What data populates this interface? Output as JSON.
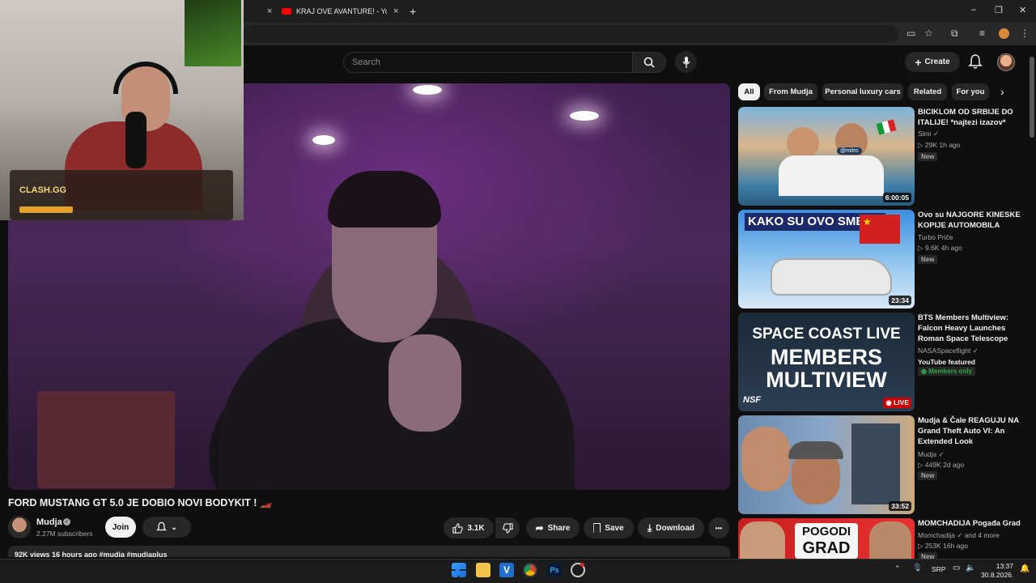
{
  "browser": {
    "tab_title": "KRAJ OVE AVANTURE! - YouTube",
    "tab_close": "×",
    "new_tab": "+",
    "window_controls": [
      "–",
      "❐",
      "✕"
    ]
  },
  "yt_header": {
    "search_placeholder": "Search",
    "create_label": "Create"
  },
  "webcam_overlay": {
    "sponsor_logo": "CLASH.GG"
  },
  "video": {
    "title": "FORD MUSTANG GT 5.0 JE DOBIO NOVI BODYKIT ! 🏎️",
    "channel": "Mudja",
    "subscribers": "2.27M subscribers",
    "join_label": "Join",
    "likes": "3.1K",
    "share_label": "Share",
    "save_label": "Save",
    "download_label": "Download",
    "more_label": "•••",
    "views_line": "92K views  16 hours ago  #mudja  #mudjaplus"
  },
  "chips": [
    "All",
    "From Mudja",
    "Personal luxury cars",
    "Related",
    "For you"
  ],
  "recommendations": [
    {
      "title": "BICIKLOM OD SRBIJE DO ITALIJE! *najtezi izazov*",
      "channel": "Simi",
      "verified": true,
      "stats": "▷ 29K  1h ago",
      "badge": "New",
      "duration": "6:00:05",
      "thumb_text": "@mitro"
    },
    {
      "title": "Ovo su NAJGORE KINESKE KOPIJE AUTOMOBILA",
      "channel": "Turbo Priče",
      "verified": false,
      "stats": "▷ 9.6K  4h ago",
      "badge": "New",
      "duration": "23:34",
      "thumb_text": "KAKO SU OVO SMELI?"
    },
    {
      "title": "BTS Members Multiview: Falcon Heavy Launches Roman Space Telescope",
      "channel": "NASASpaceflight",
      "verified": true,
      "stats": "YouTube featured",
      "badge": "Members only",
      "duration": "LIVE",
      "thumb_text_1": "SPACE COAST LIVE",
      "thumb_text_2": "MEMBERS",
      "thumb_text_3": "MULTIVIEW",
      "thumb_logo": "NSF"
    },
    {
      "title": "Mudja & Čale REAGUJU NA Grand Theft Auto VI: An Extended Look",
      "channel": "Mudja",
      "verified": true,
      "stats": "▷ 449K  2d ago",
      "badge": "New",
      "duration": "33:52"
    },
    {
      "title": "MOMCHADIJA Pogađa Grad",
      "channel": "Momchadija",
      "channel_suffix": "and 4 more",
      "verified": true,
      "stats": "▷ 253K  16h ago",
      "badge": "New",
      "thumb_text_1": "POGODI",
      "thumb_text_2": "GRAD"
    }
  ],
  "taskbar": {
    "lang": "SRP",
    "time": "13:37",
    "date": "30.8.2026."
  },
  "colors": {
    "background": "#0f0f0f",
    "surface": "#272727",
    "live_red": "#cc0000",
    "members_green": "#2ba640"
  }
}
